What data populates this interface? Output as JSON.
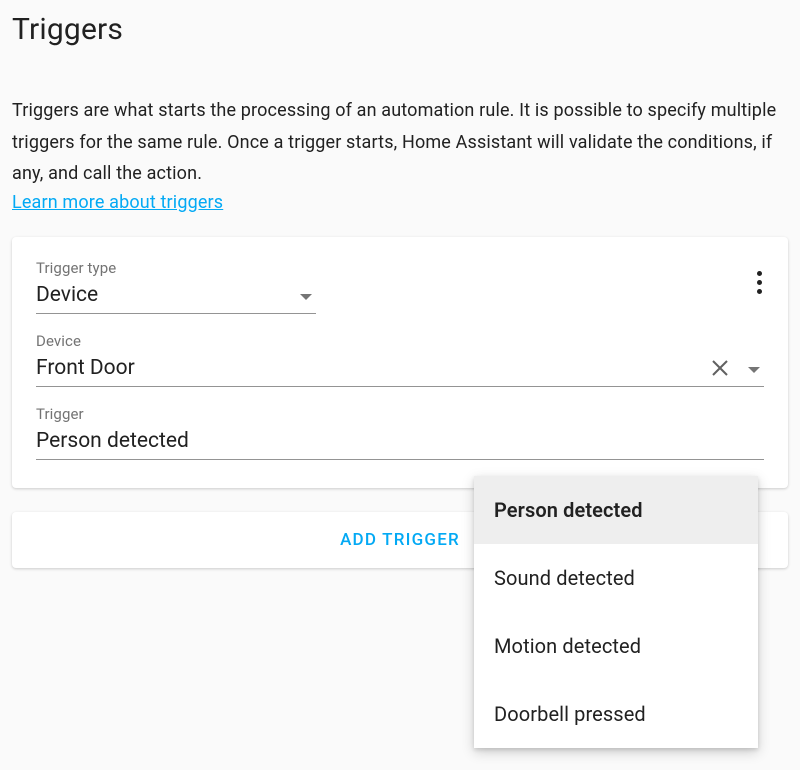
{
  "header": {
    "title": "Triggers"
  },
  "intro": {
    "text": "Triggers are what starts the processing of an automation rule. It is possible to specify multiple triggers for the same rule. Once a trigger starts, Home Assistant will validate the conditions, if any, and call the action.",
    "link_label": "Learn more about triggers"
  },
  "card": {
    "trigger_type": {
      "label": "Trigger type",
      "value": "Device"
    },
    "device": {
      "label": "Device",
      "value": "Front Door"
    },
    "trigger": {
      "label": "Trigger",
      "value": "Person detected"
    }
  },
  "dropdown": {
    "options": [
      "Person detected",
      "Sound detected",
      "Motion detected",
      "Doorbell pressed"
    ],
    "selected_index": 0
  },
  "buttons": {
    "add_trigger": "ADD TRIGGER"
  },
  "colors": {
    "accent": "#03a9f4"
  }
}
